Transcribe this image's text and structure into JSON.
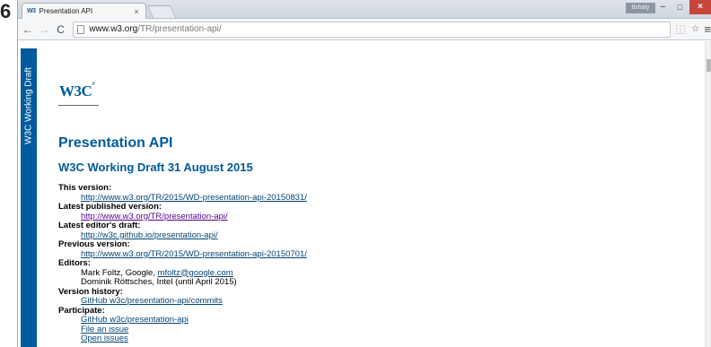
{
  "outer_mark": "6",
  "browser": {
    "tab": {
      "favicon": "W3",
      "title": "Presentation API",
      "close": "×"
    },
    "user_label": "tlshaly",
    "window_controls": {
      "minimize": "–",
      "maximize": "□",
      "close": "×"
    },
    "nav": {
      "back": "←",
      "forward": "→",
      "reload": "C"
    },
    "url": {
      "host": "www.w3.org",
      "path": "/TR/presentation-api/"
    },
    "toolbar_icons": {
      "translate": "⿰",
      "star": "☆",
      "menu": "≡"
    }
  },
  "page": {
    "side_banner": "W3C Working Draft",
    "logo": {
      "text": "W3C",
      "mark": "®"
    },
    "title": "Presentation API",
    "subtitle": "W3C Working Draft 31 August 2015",
    "meta": [
      {
        "label": "This version:",
        "values": [
          {
            "text": "http://www.w3.org/TR/2015/WD-presentation-api-20150831/",
            "link": true
          }
        ]
      },
      {
        "label": "Latest published version:",
        "values": [
          {
            "text": "http://www.w3.org/TR/presentation-api/",
            "link": true,
            "visited": true
          }
        ]
      },
      {
        "label": "Latest editor's draft:",
        "values": [
          {
            "text": "http://w3c.github.io/presentation-api/",
            "link": true
          }
        ]
      },
      {
        "label": "Previous version:",
        "values": [
          {
            "text": "http://www.w3.org/TR/2015/WD-presentation-api-20150701/",
            "link": true
          }
        ]
      },
      {
        "label": "Editors:",
        "values": [
          {
            "text": "Mark Foltz, Google, ",
            "link": false,
            "email": "mfoltz@google.com"
          },
          {
            "text": "Dominik Röttsches, Intel (until April 2015)",
            "link": false
          }
        ]
      },
      {
        "label": "Version history:",
        "values": [
          {
            "text": "GitHub w3c/presentation-api/commits",
            "link": true
          }
        ]
      },
      {
        "label": "Participate:",
        "values": [
          {
            "text": "GitHub w3c/presentation-api",
            "link": true
          },
          {
            "text": "File an issue",
            "link": true
          },
          {
            "text": "Open issues",
            "link": true
          }
        ]
      }
    ]
  }
}
